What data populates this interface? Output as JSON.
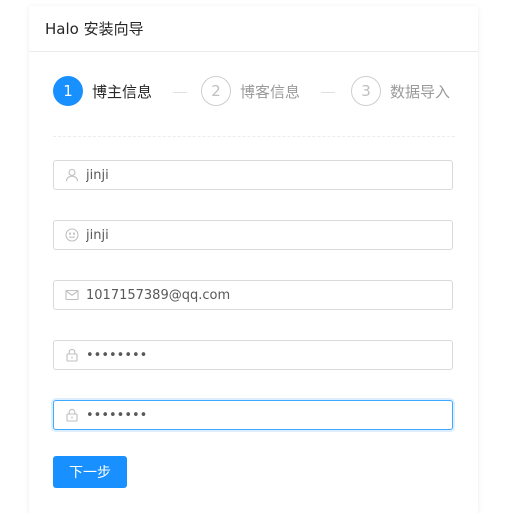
{
  "header": {
    "title": "Halo 安装向导"
  },
  "steps": [
    {
      "number": "1",
      "label": "博主信息",
      "state": "active"
    },
    {
      "number": "2",
      "label": "博客信息",
      "state": "wait"
    },
    {
      "number": "3",
      "label": "数据导入",
      "state": "wait"
    }
  ],
  "form": {
    "username": {
      "icon": "user-icon",
      "value": "jinji"
    },
    "nickname": {
      "icon": "smile-icon",
      "value": "jinji"
    },
    "email": {
      "icon": "mail-icon",
      "value": "1017157389@qq.com"
    },
    "password": {
      "icon": "lock-icon",
      "value": "12345678"
    },
    "confirm_password": {
      "icon": "lock-icon",
      "value": "12345678"
    }
  },
  "actions": {
    "next_label": "下一步"
  },
  "colors": {
    "primary": "#1890ff",
    "focus_border": "#40a9ff"
  }
}
